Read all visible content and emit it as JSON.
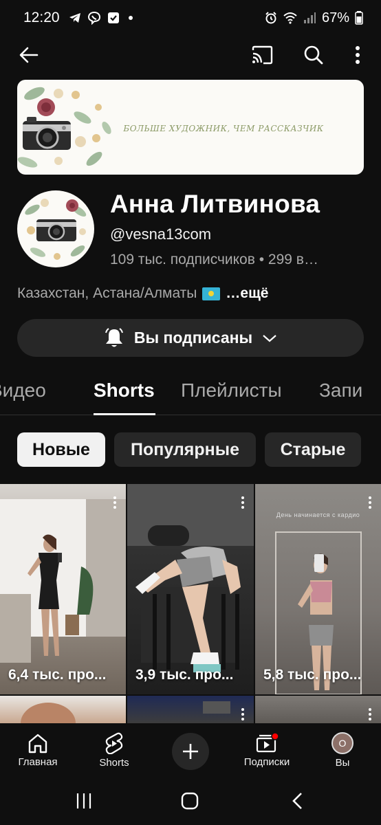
{
  "status_bar": {
    "time": "12:20",
    "battery": "67%"
  },
  "banner": {
    "text": "БОЛЬШЕ ХУДОЖНИК, ЧЕМ РАССКАЗЧИК"
  },
  "channel": {
    "name": "Анна Литвинова",
    "handle": "@vesna13com",
    "stats": "109 тыс. подписчиков • 299 в…",
    "location": "Казахстан, Астана/Алматы",
    "more": "…ещё"
  },
  "subscribe_button": {
    "label": "Вы подписаны"
  },
  "tabs": [
    {
      "label": "Видео"
    },
    {
      "label": "Shorts"
    },
    {
      "label": "Плейлисты"
    },
    {
      "label": "Запи"
    }
  ],
  "chips": [
    {
      "label": "Новые",
      "selected": true
    },
    {
      "label": "Популярные",
      "selected": false
    },
    {
      "label": "Старые",
      "selected": false
    }
  ],
  "shorts": [
    {
      "views": "6,4 тыс. про..."
    },
    {
      "views": "3,9 тыс. про..."
    },
    {
      "views": "5,8 тыс. про...",
      "caption": "День начинается с кардио"
    }
  ],
  "bottom_nav": [
    {
      "label": "Главная",
      "icon": "home-icon"
    },
    {
      "label": "Shorts",
      "icon": "shorts-icon"
    },
    {
      "label": "",
      "icon": "plus-icon"
    },
    {
      "label": "Подписки",
      "icon": "subscriptions-icon"
    },
    {
      "label": "Вы",
      "icon": "avatar",
      "avatar_letter": "О"
    }
  ],
  "colors": {
    "background": "#0f0f0f",
    "surface": "#272727",
    "accent_red": "#ff0000",
    "secondary_text": "#aaaaaa"
  }
}
